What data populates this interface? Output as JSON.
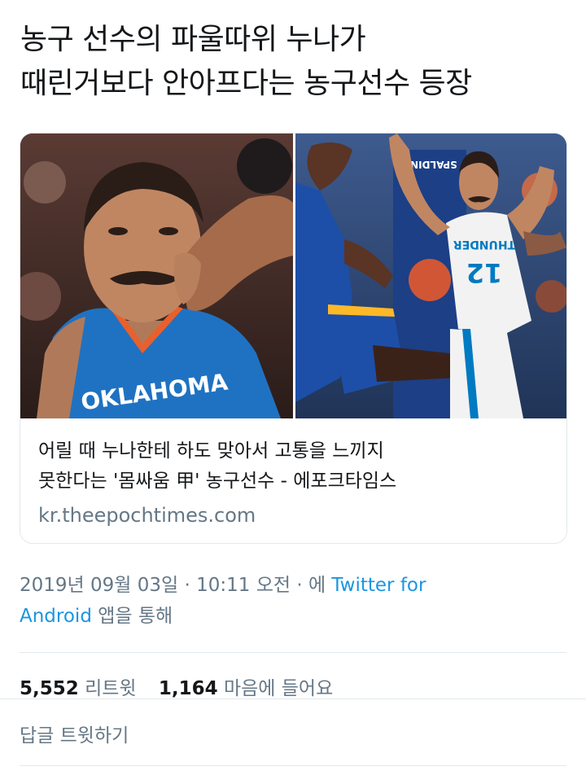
{
  "headline": {
    "line1": "농구 선수의 파울따위 누나가",
    "line2": "때린거보다 안아프다는 농구선수 등장"
  },
  "link_card": {
    "title_line1": "어릴 때 누나한테 하도 맞아서 고통을 느끼지",
    "title_line2": "못한다는 '몸싸움 甲' 농구선수 - 에포크타임스",
    "domain": "kr.theepochtimes.com",
    "left_image": {
      "jersey_text": "OKLAHOMA"
    },
    "right_image": {
      "court_text": "SPALDING",
      "jersey_text": "THUNDER",
      "jersey_number": "12"
    }
  },
  "meta": {
    "timestamp": "2019년 09월 03일 · 10:11 오전 · 에",
    "client_link_line1": "Twitter for",
    "client_link_line2": "Android",
    "client_suffix": "앱을 통해"
  },
  "stats": {
    "retweets_count": "5,552",
    "retweets_label": "리트윗",
    "likes_count": "1,164",
    "likes_label": "마음에 들어요"
  },
  "actions": {
    "reply_label": "답글 트윗하기"
  },
  "colors": {
    "text_primary": "#14171a",
    "text_secondary": "#657786",
    "link": "#1b95e0",
    "divider": "#e1e8ed",
    "thunder_blue": "#007ac1",
    "warriors_blue": "#1d4fa8",
    "warriors_gold": "#fdb927"
  }
}
